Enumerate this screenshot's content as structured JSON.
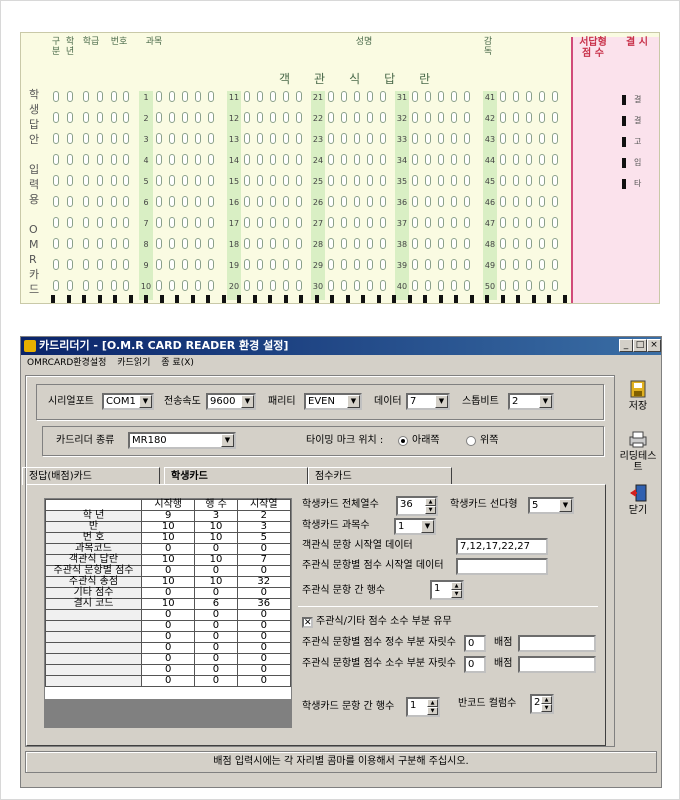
{
  "omr_card": {
    "side_title": [
      "학",
      "생",
      "답",
      "안",
      "",
      "입",
      "력",
      "용",
      "",
      "O",
      "M",
      "R",
      "카",
      "드"
    ],
    "headers": [
      "구분",
      "학년",
      "학급",
      "번호",
      "과목",
      "성명",
      "감독"
    ],
    "objective_label": "객관식답란",
    "red_headers": [
      "서답형 점 수",
      "결 시"
    ],
    "red_labels": [
      "결",
      "결",
      "고",
      "입",
      "타"
    ],
    "question_start": [
      1,
      11,
      21,
      31,
      41
    ]
  },
  "window": {
    "title": "카드리더기 - [O.M.R CARD READER 환경 설정]",
    "controls": [
      "_",
      "□",
      "×"
    ],
    "menu": [
      "OMRCARD환경설정",
      "카드읽기",
      "종 료(X)"
    ]
  },
  "serial": {
    "port_label": "시리얼포트",
    "port_value": "COM1",
    "speed_label": "전송속도",
    "speed_value": "9600",
    "parity_label": "패리티",
    "parity_value": "EVEN",
    "data_label": "데이터",
    "data_value": "7",
    "stop_label": "스톱비트",
    "stop_value": "2"
  },
  "reader": {
    "type_label": "카드리더 종류",
    "type_value": "MR180",
    "timing_label": "타이밍 마크 위치 :",
    "radio_bottom": "아래쪽",
    "radio_top": "위쪽"
  },
  "tabs": [
    "정답(배점)카드",
    "학생카드",
    "점수카드"
  ],
  "grid": {
    "columns": [
      "시작행",
      "행 수",
      "시작열"
    ],
    "rows": [
      {
        "label": "학 년",
        "v": [
          "9",
          "3",
          "2"
        ]
      },
      {
        "label": "반",
        "v": [
          "10",
          "10",
          "3"
        ]
      },
      {
        "label": "번 호",
        "v": [
          "10",
          "10",
          "5"
        ]
      },
      {
        "label": "과목코드",
        "v": [
          "0",
          "0",
          "0"
        ]
      },
      {
        "label": "객관식 답란",
        "v": [
          "10",
          "10",
          "7"
        ]
      },
      {
        "label": "주관식 문항별 점수",
        "v": [
          "0",
          "0",
          "0"
        ]
      },
      {
        "label": "주관식 총점",
        "v": [
          "10",
          "10",
          "32"
        ]
      },
      {
        "label": "기타 점수",
        "v": [
          "0",
          "0",
          "0"
        ]
      },
      {
        "label": "결시 코드",
        "v": [
          "10",
          "6",
          "36"
        ]
      },
      {
        "label": "",
        "v": [
          "0",
          "0",
          "0"
        ]
      },
      {
        "label": "",
        "v": [
          "0",
          "0",
          "0"
        ]
      },
      {
        "label": "",
        "v": [
          "0",
          "0",
          "0"
        ]
      },
      {
        "label": "",
        "v": [
          "0",
          "0",
          "0"
        ]
      },
      {
        "label": "",
        "v": [
          "0",
          "0",
          "0"
        ]
      },
      {
        "label": "",
        "v": [
          "0",
          "0",
          "0"
        ]
      },
      {
        "label": "",
        "v": [
          "0",
          "0",
          "0"
        ]
      }
    ]
  },
  "settings": {
    "total_cols_label": "학생카드 전체열수",
    "total_cols": "36",
    "lead_label": "학생카드 선다형",
    "lead_value": "5",
    "subjects_label": "학생카드 과목수",
    "subjects_value": "1",
    "obj_start_label": "객관식 문항 시작열 데이터",
    "obj_start_value": "7,12,17,22,27",
    "subj_start_label": "주관식 문항별 점수 시작열 데이터",
    "subj_start_value": "",
    "subj_rows_label": "주관식 문항 간 행수",
    "subj_rows_value": "1",
    "decimal_label": "주관식/기타 점수 소수 부분 유무",
    "int_digits_label": "주관식 문항별 점수 정수 부분 자릿수",
    "int_digits_value": "0",
    "frac_digits_label": "주관식 문항별 점수 소수 부분 자릿수",
    "frac_digits_value": "0",
    "weight_label": "배점",
    "weight_value_1": "",
    "weight_value_2": "",
    "q_rows_label": "학생카드 문항 간 행수",
    "q_rows_value": "1",
    "barcode_label": "반코드 컬럼수",
    "barcode_value": "2"
  },
  "toolbar": [
    {
      "icon": "save-icon",
      "label": "저장"
    },
    {
      "icon": "reader-test-icon",
      "label": "리딩테스트"
    },
    {
      "icon": "exit-door-icon",
      "label": "닫기"
    }
  ],
  "status": "배점 입력시에는 각 자리별 콤마를 이용해서 구분해 주십시오."
}
